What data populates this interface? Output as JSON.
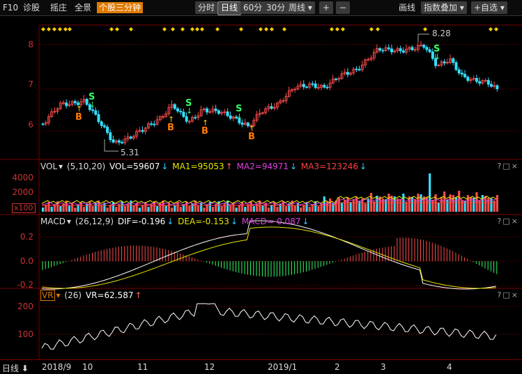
{
  "toolbar": {
    "left": [
      "F10",
      "诊股",
      "摇庄",
      "全景"
    ],
    "active": "个股三分钟",
    "periods": [
      "分时",
      "日线",
      "60分",
      "30分",
      "周线 ▾"
    ],
    "selected_period": "日线",
    "right": [
      "画线",
      "指数叠加 ▾",
      "+自选 ▾"
    ]
  },
  "price_panel": {
    "y_ticks": [
      "8",
      "7",
      "6"
    ],
    "high_label": "8.28",
    "low_label": "5.31",
    "signals": [
      "B",
      "S"
    ]
  },
  "vol_panel": {
    "name": "VOL",
    "params": "(5,10,20)",
    "vol": "VOL=59607",
    "ma1": "MA1=95053",
    "ma2": "MA2=94971",
    "ma3": "MA3=123246",
    "y_ticks": [
      "4000",
      "2000"
    ],
    "unit": "x100",
    "colors": {
      "ma1": "#e6e600",
      "ma2": "#e040e0",
      "ma3": "#ff4040"
    }
  },
  "macd_panel": {
    "name": "MACD",
    "params": "(26,12,9)",
    "dif": "DIF=-0.196",
    "dea": "DEA=-0.153",
    "macd": "MACD=-0.087",
    "y_ticks": [
      "0.2",
      "0.0",
      "-0.2"
    ]
  },
  "vr_panel": {
    "name": "VR",
    "params": "(26)",
    "vr": "VR=62.587",
    "y_ticks": [
      "200",
      "100"
    ]
  },
  "x_axis": {
    "label": "日线",
    "ticks": [
      "2018/9",
      "10",
      "11",
      "12",
      "2019/1",
      "2",
      "3",
      "4"
    ]
  },
  "panel_controls": "?□×"
}
